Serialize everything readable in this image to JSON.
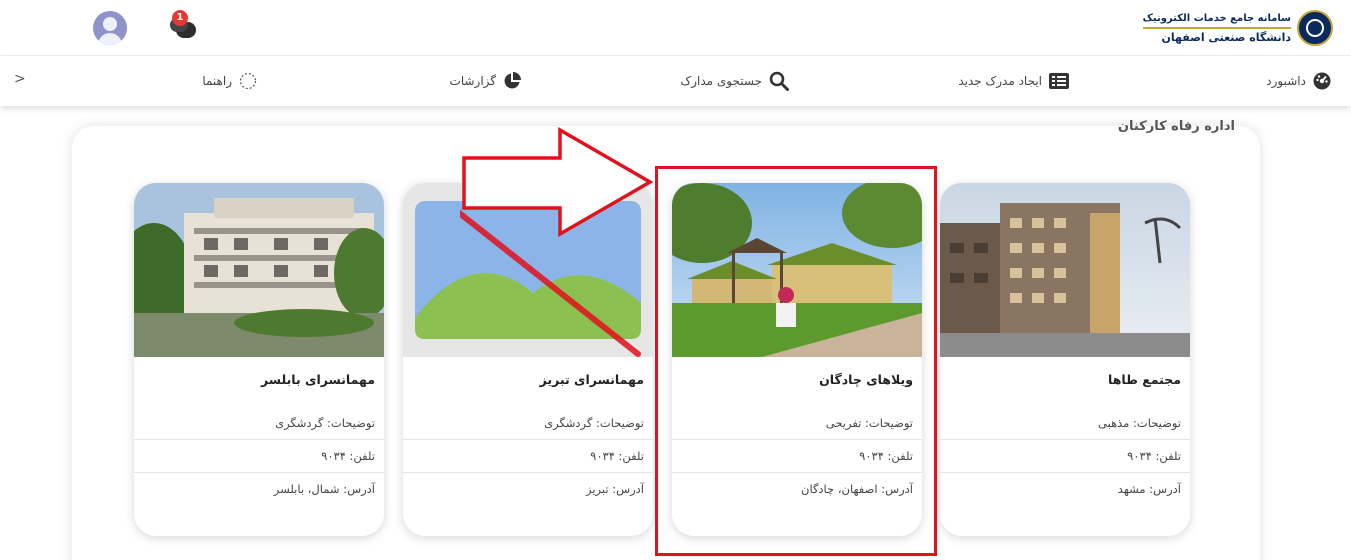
{
  "header": {
    "brand_line1": "سامانه جامع خدمات الکترونیک",
    "brand_line2": "دانشگاه صنعتی اصفهان",
    "notification_count": "1",
    "logo_icon": "university-seal-icon",
    "avatar_icon": "user-avatar-icon",
    "notification_icon": "chat-bubbles-icon"
  },
  "nav": {
    "items": [
      {
        "label": "داشبورد",
        "icon": "dashboard-gauge-icon"
      },
      {
        "label": "ایجاد مدرک جدید",
        "icon": "list-icon"
      },
      {
        "label": "جستجوی مدارک",
        "icon": "search-icon"
      },
      {
        "label": "گزارشات",
        "icon": "pie-chart-icon"
      },
      {
        "label": "راهنما",
        "icon": "help-circle-icon"
      }
    ],
    "chevron": ">"
  },
  "section": {
    "title": "اداره رفاه کارکنان"
  },
  "cards": [
    {
      "title": "مجتمع طاها",
      "desc": "توضیحات: مذهبی",
      "phone": "تلفن: ۹۰۳۴",
      "address": "آدرس: مشهد",
      "image": "apartment-building-photo"
    },
    {
      "title": "ویلاهای چادگان",
      "desc": "توضیحات: تفریحی",
      "phone": "تلفن: ۹۰۳۴",
      "address": "آدرس: اصفهان، چادگان",
      "image": "villa-photo"
    },
    {
      "title": "مهمانسرای تبریز",
      "desc": "توضیحات: گردشگری",
      "phone": "تلفن: ۹۰۳۴",
      "address": "آدرس: تبریز",
      "image": "image-placeholder-icon"
    },
    {
      "title": "مهمانسرای بابلسر",
      "desc": "توضیحات: گردشگری",
      "phone": "تلفن: ۹۰۳۴",
      "address": "آدرس: شمال، بابلسر",
      "image": "guesthouse-building-photo"
    }
  ],
  "annotation": {
    "highlight_color": "#e0121d",
    "arrow_icon": "right-arrow-annotation-icon",
    "strike_icon": "red-strike-line-icon"
  },
  "colors": {
    "brand_navy": "#0b2a5c",
    "brand_gold": "#c9a43b",
    "avatar": "#8e93c9",
    "badge": "#e53935"
  }
}
